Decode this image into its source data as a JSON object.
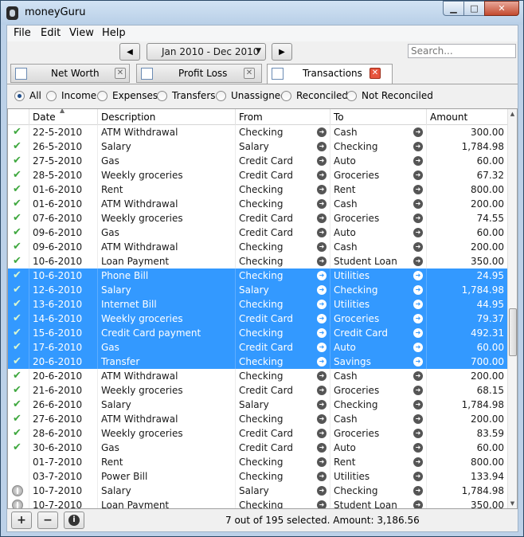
{
  "app": {
    "title": "moneyGuru"
  },
  "menu": [
    "File",
    "Edit",
    "View",
    "Help"
  ],
  "toolbar": {
    "prev": "◀",
    "next": "▶",
    "date_range": "Jan 2010 - Dec 2010",
    "search_placeholder": "Search..."
  },
  "tabs": [
    {
      "label": "Net Worth",
      "icon": "chart-icon",
      "active": false
    },
    {
      "label": "Profit  Loss",
      "icon": "bar-chart-icon",
      "active": false
    },
    {
      "label": "Transactions",
      "icon": "ledger-icon",
      "active": true
    }
  ],
  "filters": [
    {
      "label": "All",
      "checked": true
    },
    {
      "label": "Income",
      "checked": false
    },
    {
      "label": "Expenses",
      "checked": false
    },
    {
      "label": "Transfers",
      "checked": false
    },
    {
      "label": "Unassigned",
      "checked": false
    },
    {
      "label": "Reconciled",
      "checked": false
    },
    {
      "label": "Not Reconciled",
      "checked": false
    }
  ],
  "columns": {
    "date": "Date",
    "description": "Description",
    "from": "From",
    "to": "To",
    "amount": "Amount"
  },
  "transactions": [
    {
      "status": "reconciled",
      "date": "22-5-2010",
      "description": "ATM Withdrawal",
      "from": "Checking",
      "to": "Cash",
      "amount": "300.00",
      "selected": false
    },
    {
      "status": "reconciled",
      "date": "26-5-2010",
      "description": "Salary",
      "from": "Salary",
      "to": "Checking",
      "amount": "1,784.98",
      "selected": false
    },
    {
      "status": "reconciled",
      "date": "27-5-2010",
      "description": "Gas",
      "from": "Credit Card",
      "to": "Auto",
      "amount": "60.00",
      "selected": false
    },
    {
      "status": "reconciled",
      "date": "28-5-2010",
      "description": "Weekly groceries",
      "from": "Credit Card",
      "to": "Groceries",
      "amount": "67.32",
      "selected": false
    },
    {
      "status": "reconciled",
      "date": "01-6-2010",
      "description": "Rent",
      "from": "Checking",
      "to": "Rent",
      "amount": "800.00",
      "selected": false
    },
    {
      "status": "reconciled",
      "date": "01-6-2010",
      "description": "ATM Withdrawal",
      "from": "Checking",
      "to": "Cash",
      "amount": "200.00",
      "selected": false
    },
    {
      "status": "reconciled",
      "date": "07-6-2010",
      "description": "Weekly groceries",
      "from": "Credit Card",
      "to": "Groceries",
      "amount": "74.55",
      "selected": false
    },
    {
      "status": "reconciled",
      "date": "09-6-2010",
      "description": "Gas",
      "from": "Credit Card",
      "to": "Auto",
      "amount": "60.00",
      "selected": false
    },
    {
      "status": "reconciled",
      "date": "09-6-2010",
      "description": "ATM Withdrawal",
      "from": "Checking",
      "to": "Cash",
      "amount": "200.00",
      "selected": false
    },
    {
      "status": "reconciled",
      "date": "10-6-2010",
      "description": "Loan Payment",
      "from": "Checking",
      "to": "Student Loan",
      "amount": "350.00",
      "selected": false
    },
    {
      "status": "reconciled",
      "date": "10-6-2010",
      "description": "Phone Bill",
      "from": "Checking",
      "to": "Utilities",
      "amount": "24.95",
      "selected": true
    },
    {
      "status": "reconciled",
      "date": "12-6-2010",
      "description": "Salary",
      "from": "Salary",
      "to": "Checking",
      "amount": "1,784.98",
      "selected": true
    },
    {
      "status": "reconciled",
      "date": "13-6-2010",
      "description": "Internet Bill",
      "from": "Checking",
      "to": "Utilities",
      "amount": "44.95",
      "selected": true
    },
    {
      "status": "reconciled",
      "date": "14-6-2010",
      "description": "Weekly groceries",
      "from": "Credit Card",
      "to": "Groceries",
      "amount": "79.37",
      "selected": true
    },
    {
      "status": "reconciled",
      "date": "15-6-2010",
      "description": "Credit Card payment",
      "from": "Checking",
      "to": "Credit Card",
      "amount": "492.31",
      "selected": true
    },
    {
      "status": "reconciled",
      "date": "17-6-2010",
      "description": "Gas",
      "from": "Credit Card",
      "to": "Auto",
      "amount": "60.00",
      "selected": true
    },
    {
      "status": "reconciled",
      "date": "20-6-2010",
      "description": "Transfer",
      "from": "Checking",
      "to": "Savings",
      "amount": "700.00",
      "selected": true
    },
    {
      "status": "reconciled",
      "date": "20-6-2010",
      "description": "ATM Withdrawal",
      "from": "Checking",
      "to": "Cash",
      "amount": "200.00",
      "selected": false
    },
    {
      "status": "reconciled",
      "date": "21-6-2010",
      "description": "Weekly groceries",
      "from": "Credit Card",
      "to": "Groceries",
      "amount": "68.15",
      "selected": false
    },
    {
      "status": "reconciled",
      "date": "26-6-2010",
      "description": "Salary",
      "from": "Salary",
      "to": "Checking",
      "amount": "1,784.98",
      "selected": false
    },
    {
      "status": "reconciled",
      "date": "27-6-2010",
      "description": "ATM Withdrawal",
      "from": "Checking",
      "to": "Cash",
      "amount": "200.00",
      "selected": false
    },
    {
      "status": "reconciled",
      "date": "28-6-2010",
      "description": "Weekly groceries",
      "from": "Credit Card",
      "to": "Groceries",
      "amount": "83.59",
      "selected": false
    },
    {
      "status": "reconciled",
      "date": "30-6-2010",
      "description": "Gas",
      "from": "Credit Card",
      "to": "Auto",
      "amount": "60.00",
      "selected": false
    },
    {
      "status": "none",
      "date": "01-7-2010",
      "description": "Rent",
      "from": "Checking",
      "to": "Rent",
      "amount": "800.00",
      "selected": false
    },
    {
      "status": "none",
      "date": "03-7-2010",
      "description": "Power Bill",
      "from": "Checking",
      "to": "Utilities",
      "amount": "133.94",
      "selected": false
    },
    {
      "status": "future",
      "date": "10-7-2010",
      "description": "Salary",
      "from": "Salary",
      "to": "Checking",
      "amount": "1,784.98",
      "selected": false
    },
    {
      "status": "future",
      "date": "10-7-2010",
      "description": "Loan Payment",
      "from": "Checking",
      "to": "Student Loan",
      "amount": "350.00",
      "selected": false
    }
  ],
  "bottom": {
    "add": "+",
    "remove": "−",
    "info": "i",
    "status": "7 out of 195 selected. Amount: 3,186.56"
  },
  "colors": {
    "selection": "#3399ff",
    "reconciled_check": "#3fa83f",
    "close_button": "#e7553e"
  }
}
